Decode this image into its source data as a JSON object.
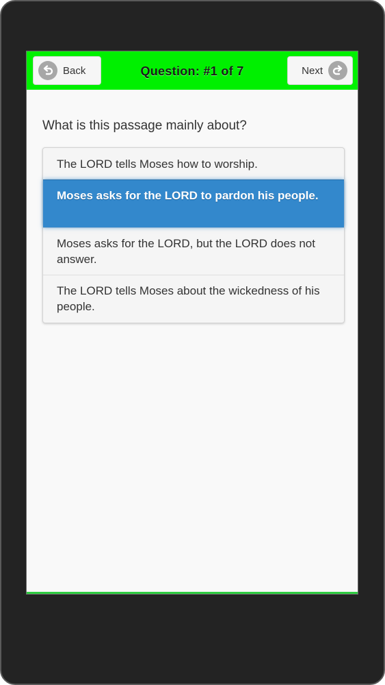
{
  "header": {
    "back_label": "Back",
    "title": "Question: #1 of 7",
    "next_label": "Next",
    "back_icon": "back-arrow-icon",
    "next_icon": "forward-arrow-icon",
    "accent_color": "#00f000"
  },
  "question": {
    "text": "What is this passage mainly about?"
  },
  "options": [
    {
      "text": "The LORD tells Moses how to worship.",
      "selected": false
    },
    {
      "text": "Moses asks for the LORD to pardon his people.",
      "selected": true
    },
    {
      "text": "Moses asks for the LORD, but the LORD does not answer.",
      "selected": false
    },
    {
      "text": "The LORD tells Moses about the wickedness of his people.",
      "selected": false
    }
  ],
  "colors": {
    "selected_option": "#3388cc",
    "device_frame": "#232323"
  }
}
